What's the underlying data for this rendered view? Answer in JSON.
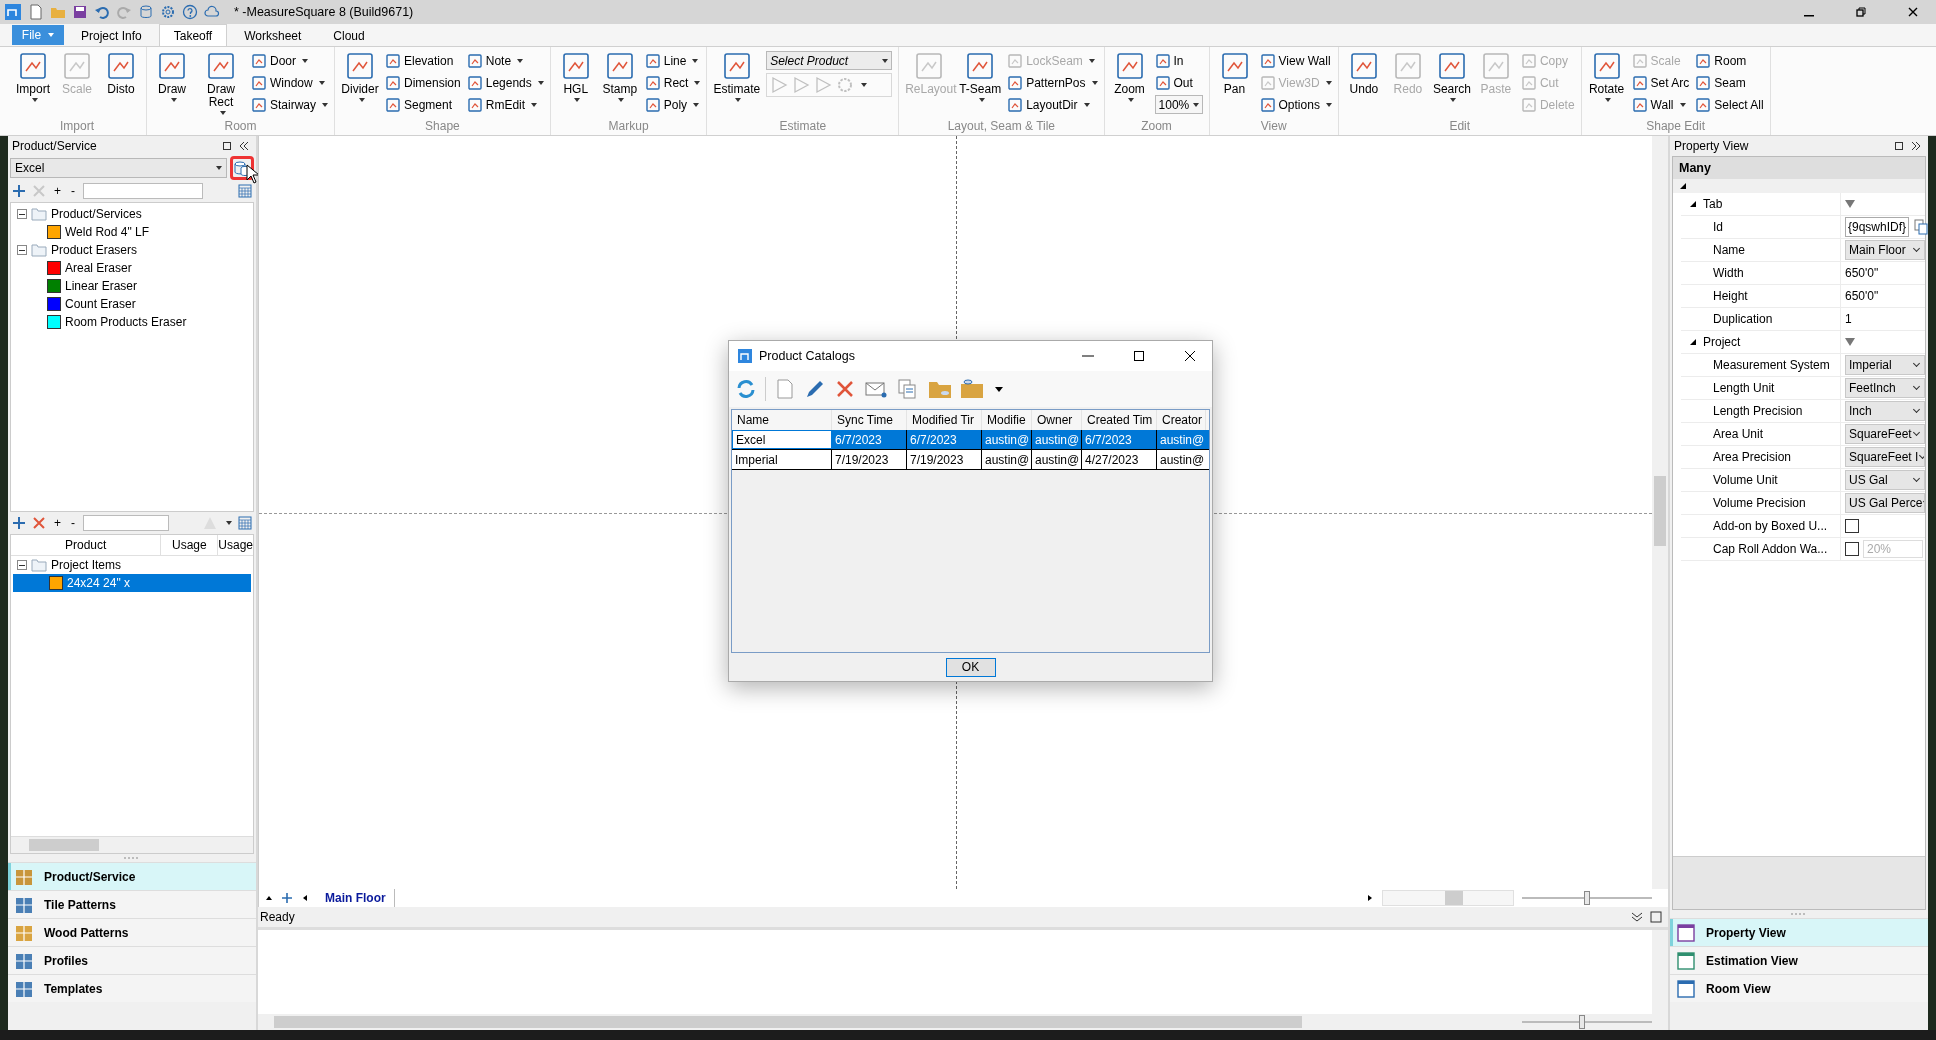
{
  "title_bar": {
    "title": "* -MeasureSquare 8 (Build9671)"
  },
  "ribbon": {
    "file": "File",
    "tabs": [
      {
        "label": "Project Info",
        "selected": false
      },
      {
        "label": "Takeoff",
        "selected": true
      },
      {
        "label": "Worksheet",
        "selected": false
      },
      {
        "label": "Cloud",
        "selected": false
      }
    ],
    "groups": [
      {
        "label": "Import",
        "columns": [
          {
            "kind": "large",
            "label": "Import",
            "disabled": false,
            "menu": true
          },
          {
            "kind": "large",
            "label": "Scale",
            "disabled": true,
            "menu": false
          },
          {
            "kind": "large",
            "label": "Disto",
            "disabled": false,
            "menu": false
          }
        ]
      },
      {
        "label": "Room",
        "columns": [
          {
            "kind": "large",
            "label": "Draw",
            "disabled": false,
            "menu": true
          },
          {
            "kind": "large",
            "label": "Draw Rect",
            "disabled": false,
            "menu": true
          },
          {
            "kind": "stack",
            "items": [
              {
                "kind": "small",
                "label": "Door",
                "disabled": false,
                "menu": true
              },
              {
                "kind": "small",
                "label": "Window",
                "disabled": false,
                "menu": true
              },
              {
                "kind": "small",
                "label": "Stairway",
                "disabled": false,
                "menu": true
              }
            ]
          }
        ]
      },
      {
        "label": "Shape",
        "columns": [
          {
            "kind": "large",
            "label": "Divider",
            "disabled": false,
            "menu": true
          },
          {
            "kind": "stack",
            "items": [
              {
                "kind": "small",
                "label": "Elevation",
                "disabled": false,
                "menu": false
              },
              {
                "kind": "small",
                "label": "Dimension",
                "disabled": false,
                "menu": false
              },
              {
                "kind": "small",
                "label": "Segment",
                "disabled": false,
                "menu": false
              }
            ]
          },
          {
            "kind": "stack",
            "items": [
              {
                "kind": "small",
                "label": "Note",
                "disabled": false,
                "menu": true
              },
              {
                "kind": "small",
                "label": "Legends",
                "disabled": false,
                "menu": true
              },
              {
                "kind": "small",
                "label": "RmEdit",
                "disabled": false,
                "menu": true
              }
            ]
          }
        ]
      },
      {
        "label": "Markup",
        "columns": [
          {
            "kind": "large",
            "label": "HGL",
            "disabled": false,
            "menu": true
          },
          {
            "kind": "large",
            "label": "Stamp",
            "disabled": false,
            "menu": true
          },
          {
            "kind": "stack",
            "items": [
              {
                "kind": "small",
                "label": "Line",
                "disabled": false,
                "menu": true
              },
              {
                "kind": "small",
                "label": "Rect",
                "disabled": false,
                "menu": true
              },
              {
                "kind": "small",
                "label": "Poly",
                "disabled": false,
                "menu": true
              }
            ]
          }
        ]
      },
      {
        "label": "Estimate",
        "columns": [
          {
            "kind": "large",
            "label": "Estimate",
            "disabled": false,
            "menu": true
          },
          {
            "kind": "stack",
            "items": [
              {
                "kind": "combo",
                "placeholder": "Select Product"
              },
              {
                "kind": "tools",
                "disabled": true
              }
            ]
          }
        ]
      },
      {
        "label": "Layout, Seam & Tile",
        "columns": [
          {
            "kind": "large",
            "label": "ReLayout",
            "disabled": true,
            "menu": false
          },
          {
            "kind": "large",
            "label": "T-Seam",
            "disabled": false,
            "menu": true
          },
          {
            "kind": "stack",
            "items": [
              {
                "kind": "small",
                "label": "LockSeam",
                "disabled": true,
                "menu": true
              },
              {
                "kind": "small",
                "label": "PatternPos",
                "disabled": false,
                "menu": true
              },
              {
                "kind": "small",
                "label": "LayoutDir",
                "disabled": false,
                "menu": true
              }
            ]
          }
        ]
      },
      {
        "label": "Zoom",
        "columns": [
          {
            "kind": "large",
            "label": "Zoom",
            "disabled": false,
            "menu": true
          },
          {
            "kind": "stack",
            "items": [
              {
                "kind": "small",
                "label": "In",
                "disabled": false,
                "menu": false
              },
              {
                "kind": "small",
                "label": "Out",
                "disabled": false,
                "menu": false
              },
              {
                "kind": "combo",
                "value": "100%"
              }
            ]
          }
        ]
      },
      {
        "label": "View",
        "columns": [
          {
            "kind": "large",
            "label": "Pan",
            "disabled": false,
            "menu": false
          },
          {
            "kind": "stack",
            "items": [
              {
                "kind": "small",
                "label": "View Wall",
                "disabled": false,
                "menu": false
              },
              {
                "kind": "small",
                "label": "View3D",
                "disabled": true,
                "menu": true
              },
              {
                "kind": "small",
                "label": "Options",
                "disabled": false,
                "menu": true
              }
            ]
          }
        ]
      },
      {
        "label": "Edit",
        "columns": [
          {
            "kind": "large",
            "label": "Undo",
            "disabled": false,
            "menu": false
          },
          {
            "kind": "large",
            "label": "Redo",
            "disabled": true,
            "menu": false
          },
          {
            "kind": "large",
            "label": "Search",
            "disabled": false,
            "menu": true
          },
          {
            "kind": "large",
            "label": "Paste",
            "disabled": true,
            "menu": false
          },
          {
            "kind": "stack",
            "items": [
              {
                "kind": "small",
                "label": "Copy",
                "disabled": true,
                "menu": false
              },
              {
                "kind": "small",
                "label": "Cut",
                "disabled": true,
                "menu": false
              },
              {
                "kind": "small",
                "label": "Delete",
                "disabled": true,
                "menu": false
              }
            ]
          }
        ]
      },
      {
        "label": "Shape Edit",
        "columns": [
          {
            "kind": "large",
            "label": "Rotate",
            "disabled": false,
            "menu": true
          },
          {
            "kind": "stack",
            "items": [
              {
                "kind": "small",
                "label": "Scale",
                "disabled": true,
                "menu": false
              },
              {
                "kind": "small",
                "label": "Set Arc",
                "disabled": false,
                "menu": false
              },
              {
                "kind": "small",
                "label": "Wall",
                "disabled": false,
                "menu": true
              }
            ]
          },
          {
            "kind": "stack",
            "items": [
              {
                "kind": "small",
                "label": "Room",
                "disabled": false,
                "menu": false
              },
              {
                "kind": "small",
                "label": "Seam",
                "disabled": false,
                "menu": false
              },
              {
                "kind": "small",
                "label": "Select All",
                "disabled": false,
                "menu": false
              }
            ]
          }
        ]
      }
    ]
  },
  "product_panel": {
    "title": "Product/Service",
    "catalog": "Excel",
    "expand": "+",
    "collapse": "-",
    "tree": [
      {
        "label": "Product/Services",
        "expanded": true,
        "children": [
          {
            "label": "Weld Rod 4\" LF",
            "color": "#ffa500"
          }
        ]
      },
      {
        "label": "Product Erasers",
        "expanded": true,
        "children": [
          {
            "label": "Areal Eraser",
            "color": "#ff0000"
          },
          {
            "label": "Linear Eraser",
            "color": "#008000"
          },
          {
            "label": "Count Eraser",
            "color": "#0000ff"
          },
          {
            "label": "Room Products Eraser",
            "color": "#00ffff"
          }
        ]
      }
    ]
  },
  "project_panel": {
    "expand": "+",
    "collapse": "-",
    "columns": [
      "Product",
      "Usage",
      "Usage"
    ],
    "tree": [
      {
        "label": "Project Items",
        "expanded": true,
        "children": [
          {
            "label": "24x24 24\" x",
            "color": "#ffa500",
            "selected": true
          }
        ]
      }
    ]
  },
  "left_nav": [
    {
      "label": "Product/Service",
      "selected": true
    },
    {
      "label": "Tile Patterns",
      "selected": false
    },
    {
      "label": "Wood Patterns",
      "selected": false
    },
    {
      "label": "Profiles",
      "selected": false
    },
    {
      "label": "Templates",
      "selected": false
    }
  ],
  "canvas": {
    "tabs": [
      {
        "label": "Main Floor",
        "selected": true
      }
    ],
    "status": "Ready",
    "page_slider": {
      "level": 0.5
    },
    "output_slider": {
      "level": 0.46
    }
  },
  "dialog": {
    "title": "Product Catalogs",
    "columns": [
      "Name",
      "Sync Time",
      "Modified Tir",
      "Modifie",
      "Owner",
      "Created Tim",
      "Creator"
    ],
    "rows": [
      {
        "selected": true,
        "cells": [
          "Excel",
          "6/7/2023",
          "6/7/2023",
          "austin@",
          "austin@",
          "6/7/2023",
          "austin@"
        ]
      },
      {
        "selected": false,
        "cells": [
          "Imperial",
          "7/19/2023",
          "7/19/2023",
          "austin@",
          "austin@",
          "4/27/2023",
          "austin@"
        ]
      }
    ],
    "ok": "OK"
  },
  "property_panel": {
    "title": "Property View",
    "object": "Many",
    "sections": [
      {
        "label": "Tab",
        "expanded": true,
        "rows": [
          {
            "label": "Id",
            "kind": "id",
            "value": "{9qswhIDf}"
          },
          {
            "label": "Name",
            "kind": "select",
            "value": "Main Floor"
          },
          {
            "label": "Width",
            "kind": "text",
            "value": "650'0\""
          },
          {
            "label": "Height",
            "kind": "text",
            "value": "650'0\""
          },
          {
            "label": "Duplication",
            "kind": "text",
            "value": "1"
          }
        ]
      },
      {
        "label": "Project",
        "expanded": true,
        "rows": [
          {
            "label": "Measurement System",
            "kind": "select",
            "value": "Imperial"
          },
          {
            "label": "Length Unit",
            "kind": "select",
            "value": "FeetInch"
          },
          {
            "label": "Length Precision",
            "kind": "select",
            "value": "Inch"
          },
          {
            "label": "Area Unit",
            "kind": "select",
            "value": "SquareFeet"
          },
          {
            "label": "Area Precision",
            "kind": "select",
            "value": "SquareFeet I"
          },
          {
            "label": "Volume Unit",
            "kind": "select",
            "value": "US Gal"
          },
          {
            "label": "Volume Precision",
            "kind": "select",
            "value": "US Gal Perce"
          },
          {
            "label": "Add-on by Boxed U...",
            "kind": "checkbox",
            "checked": false
          },
          {
            "label": "Cap Roll Addon Wa...",
            "kind": "checkbox-field",
            "checked": false,
            "placeholder": "20%"
          }
        ]
      }
    ]
  },
  "right_nav": [
    {
      "label": "Property View",
      "selected": true
    },
    {
      "label": "Estimation View",
      "selected": false
    },
    {
      "label": "Room View",
      "selected": false
    }
  ]
}
